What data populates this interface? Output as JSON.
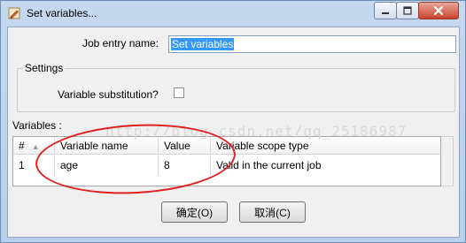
{
  "window": {
    "title": "Set variables...",
    "icon": "pencil-wrench-icon",
    "controls": [
      "minimize-icon",
      "maximize-icon",
      "close-icon"
    ]
  },
  "form": {
    "job_entry_name_label": "Job entry name:",
    "job_entry_name_value": "Set variables"
  },
  "settings": {
    "legend": "Settings",
    "variable_substitution_label": "Variable substitution?",
    "variable_substitution_checked": false
  },
  "variables": {
    "label": "Variables :",
    "columns": [
      "#",
      "Variable name",
      "Value",
      "Variable scope type"
    ],
    "rows": [
      {
        "num": "1",
        "name": "age",
        "value": "8",
        "scope": "Valid in the current job"
      }
    ]
  },
  "watermark": "http://blog.csdn.net/qq_25186987",
  "buttons": {
    "ok": "确定(O)",
    "cancel": "取消(C)"
  },
  "annotation_color": "#e0201e"
}
